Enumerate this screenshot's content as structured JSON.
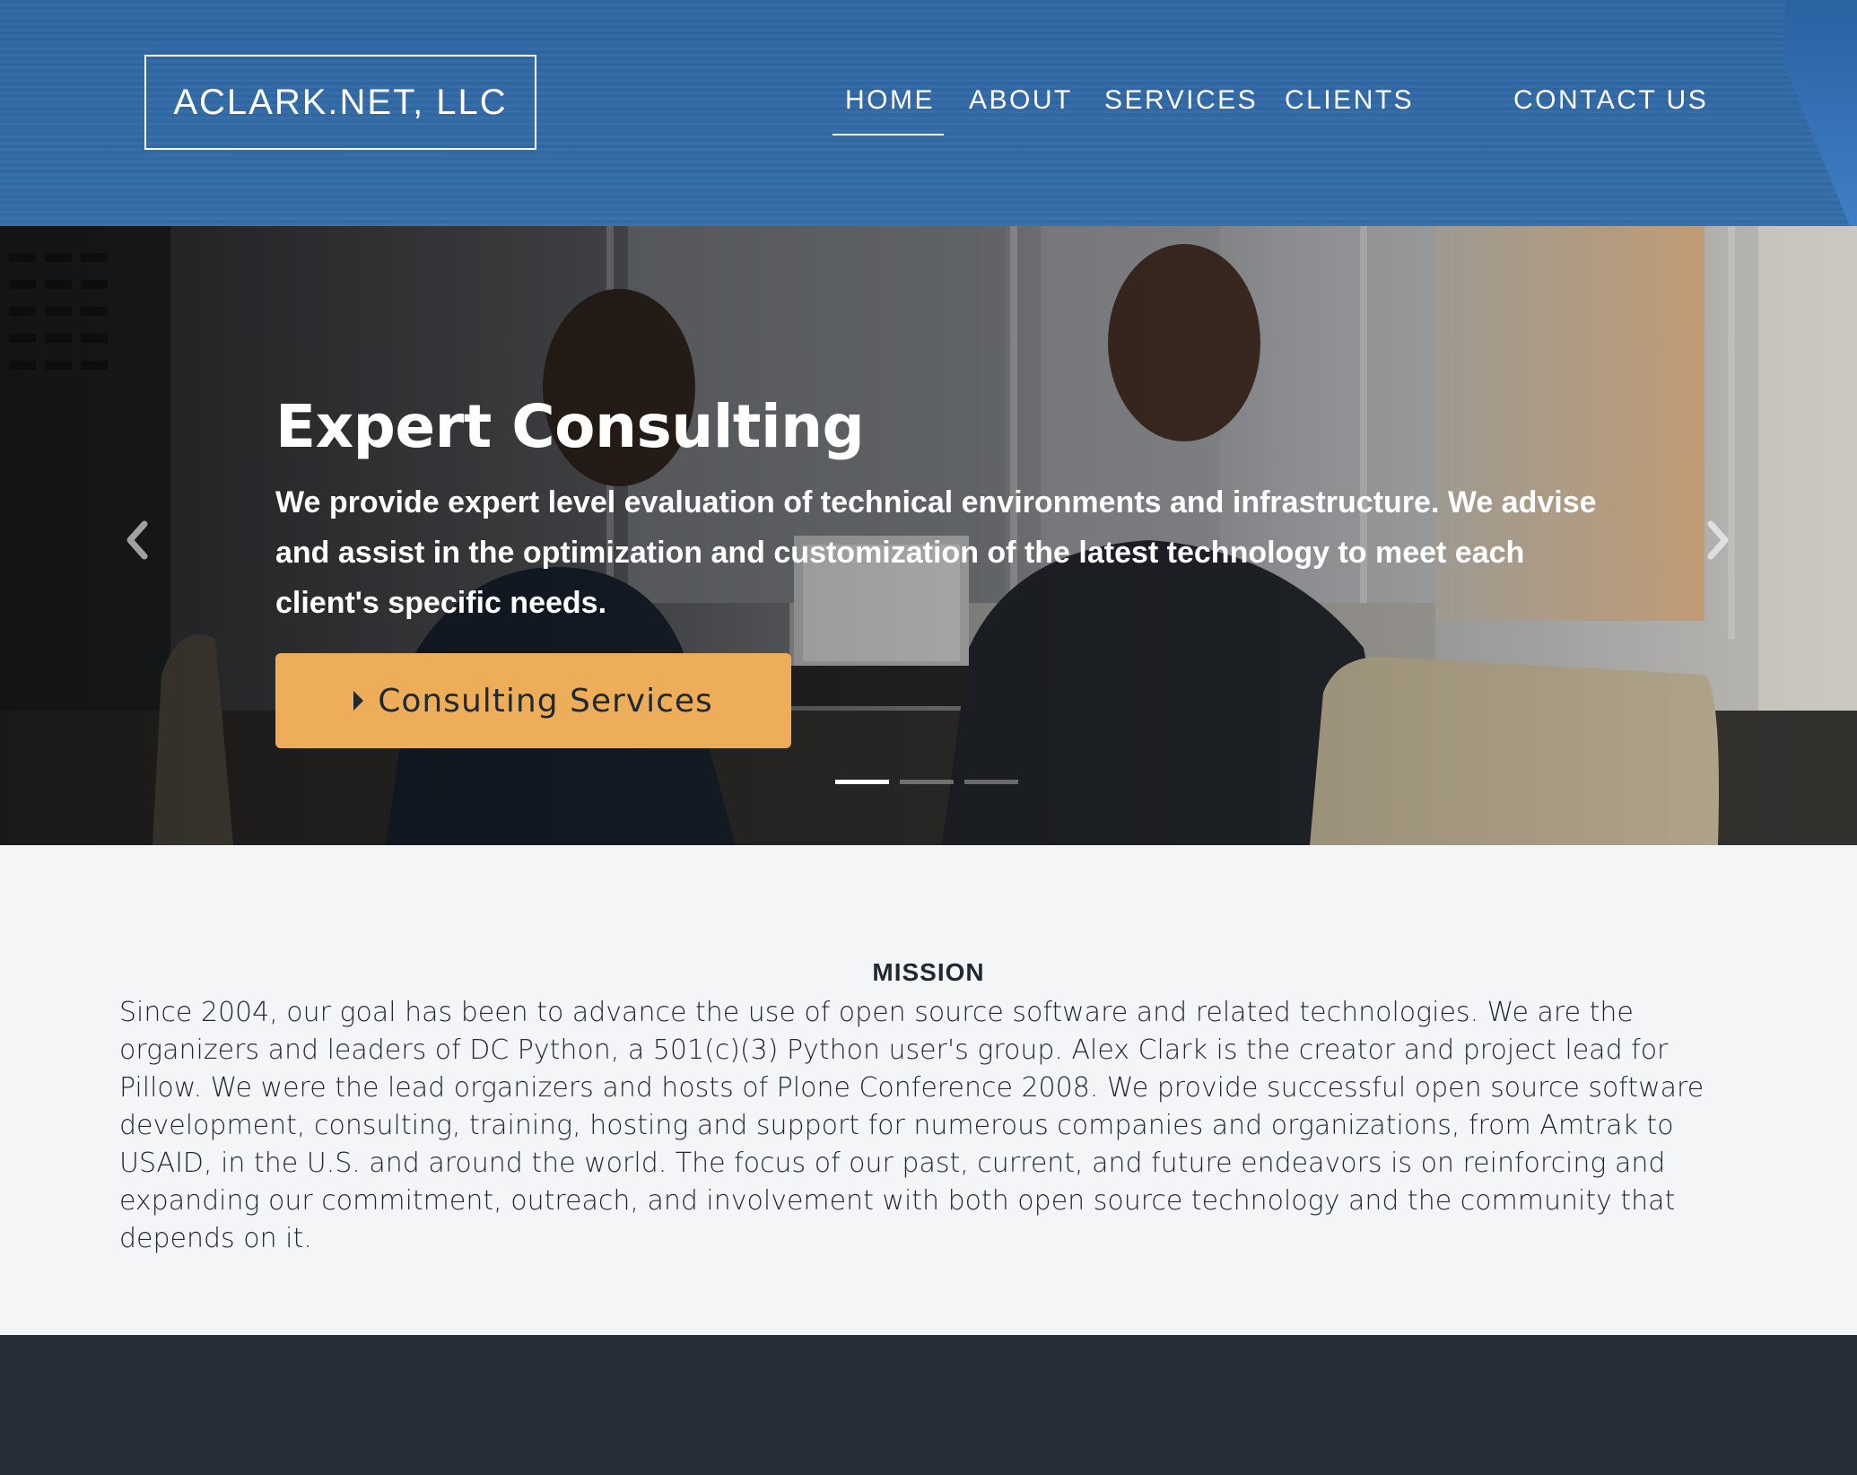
{
  "brand": {
    "logo_text": "ACLARK.NET, LLC"
  },
  "nav": {
    "items": [
      {
        "label": "HOME",
        "active": true
      },
      {
        "label": "ABOUT"
      },
      {
        "label": "SERVICES"
      },
      {
        "label": "CLIENTS"
      },
      {
        "label": "CONTACT US"
      }
    ]
  },
  "hero": {
    "title": "Expert Consulting",
    "text": "We provide expert level evaluation of technical environments and infrastructure. We advise and assist in the optimization and customization of the latest technology to meet each client's specific needs.",
    "cta_label": "Consulting Services",
    "cta_icon": "caret-right-icon",
    "prev_icon": "chevron-left-icon",
    "next_icon": "chevron-right-icon",
    "slide_count": 3,
    "active_slide": 1
  },
  "mission": {
    "heading": "MISSION",
    "text": "Since 2004, our goal has been to advance the use of open source software and related technologies. We are the organizers and leaders of DC Python, a 501(c)(3) Python user's group. Alex Clark is the creator and project lead for Pillow. We were the lead organizers and hosts of Plone Conference 2008. We provide successful open source software development, consulting, training, hosting and support for numerous companies and organizations, from Amtrak to USAID, in the U.S. and around the world. The focus of our past, current, and future endeavors is on reinforcing and expanding our commitment, outreach, and involvement with both open source technology and the community that depends on it."
  },
  "colors": {
    "header_blue": "#356ea9",
    "cta_orange": "#eeae59",
    "text_dark": "#1f2933",
    "footer_dark": "#252e38",
    "page_bg": "#f4f5f6"
  }
}
